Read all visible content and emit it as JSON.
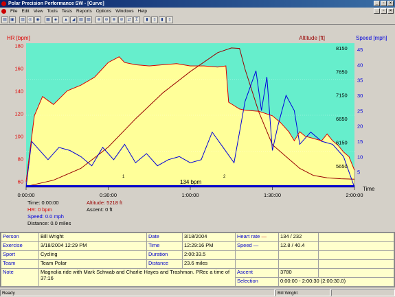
{
  "window": {
    "title": "Polar Precision Performance SW - [Curve]"
  },
  "menu": [
    "File",
    "Edit",
    "View",
    "Tools",
    "Tests",
    "Reports",
    "Options",
    "Windows",
    "Help"
  ],
  "toolbar": {
    "icons": [
      "open-icon",
      "save-icon",
      "print-icon",
      "preview-icon",
      "globe-icon",
      "calendar-icon",
      "diary-icon",
      "chart-icon",
      "chart2-icon",
      "chart3-icon",
      "chart4-icon",
      "zoom-icon",
      "zoom2-icon",
      "zoom3-icon",
      "zoom4-icon",
      "compare-icon",
      "sum-icon",
      "bar-icon",
      "bar2-icon",
      "bar3-icon",
      "bar4-icon"
    ]
  },
  "chart": {
    "hr_title": "HR [bpm]",
    "alt_title": "Altitude [ft]",
    "speed_title": "Speed [mph]",
    "time_label": "Time",
    "hr_ticks": [
      "180",
      "160",
      "140",
      "120",
      "100",
      "80",
      "60"
    ],
    "alt_ticks": [
      "8150",
      "7650",
      "7150",
      "6650",
      "6150",
      "5650"
    ],
    "speed_ticks": [
      "45",
      "40",
      "35",
      "30",
      "25",
      "20",
      "15",
      "10",
      "5"
    ],
    "time_ticks": [
      "0:00:00",
      "0:30:00",
      "1:00:00",
      "1:30:00",
      "2:00:00"
    ],
    "zone_label": "134 bpm",
    "lap_markers": [
      "1",
      "2"
    ],
    "cursor": {
      "time": "Time: 0:00:00",
      "hr": "HR: 0 bpm",
      "speed": "Speed: 0.0 mph",
      "distance": "Distance: 0.0 miles",
      "altitude": "Altitude: 5218 ft",
      "ascent": "Ascent: 0 ft"
    },
    "colors": {
      "plot_bg": "#66eecc",
      "zone_fill": "#ffff99",
      "hr": "#dd0000",
      "speed": "#0000dd",
      "altitude": "#990000"
    }
  },
  "chart_data": {
    "type": "line",
    "xlabel": "Time",
    "xlim": [
      "0:00:00",
      "2:00:00"
    ],
    "series": [
      {
        "name": "HR [bpm]",
        "axis": "left",
        "ylim": [
          55,
          182
        ],
        "x_min": [
          0,
          3,
          6,
          10,
          15,
          20,
          25,
          30,
          34,
          36,
          40,
          45,
          50,
          55,
          60,
          65,
          70,
          73,
          74,
          78,
          80,
          85,
          90,
          93,
          96,
          98,
          100,
          102,
          105,
          108,
          110,
          112,
          114,
          116,
          118,
          120
        ],
        "values": [
          60,
          118,
          135,
          128,
          140,
          145,
          152,
          165,
          170,
          165,
          163,
          162,
          163,
          164,
          162,
          162,
          161,
          162,
          130,
          124,
          123,
          122,
          118,
          112,
          104,
          96,
          104,
          100,
          98,
          96,
          102,
          96,
          92,
          86,
          82,
          70
        ]
      },
      {
        "name": "Altitude [ft]",
        "axis": "right",
        "ylim": [
          5200,
          8250
        ],
        "x_min": [
          0,
          10,
          20,
          30,
          40,
          50,
          60,
          70,
          75,
          78,
          80,
          85,
          90,
          95,
          100,
          105,
          110,
          115,
          120
        ],
        "values": [
          5218,
          5350,
          5600,
          6050,
          6650,
          7200,
          7650,
          8050,
          8150,
          8140,
          7700,
          6800,
          6100,
          5850,
          5600,
          5450,
          5400,
          5380,
          5370
        ]
      },
      {
        "name": "Speed [mph]",
        "axis": "right",
        "ylim": [
          0,
          47
        ],
        "x_min": [
          0,
          2,
          5,
          8,
          12,
          16,
          20,
          24,
          28,
          32,
          36,
          40,
          44,
          48,
          52,
          56,
          60,
          64,
          68,
          72,
          76,
          80,
          84,
          86,
          88,
          90,
          92,
          95,
          98,
          100,
          104,
          108,
          112,
          116,
          120
        ],
        "values": [
          0,
          15,
          12,
          9,
          13,
          12,
          10,
          7,
          13,
          9,
          14,
          8,
          11,
          7,
          9,
          10,
          8,
          9,
          18,
          13,
          8,
          28,
          38,
          25,
          36,
          12,
          20,
          30,
          25,
          14,
          18,
          15,
          14,
          10,
          0
        ]
      }
    ]
  },
  "summary": {
    "person_label": "Person",
    "person": "Bill Wright",
    "date_label": "Date",
    "date": "3/18/2004",
    "hr_label": "Heart rate",
    "hr": "134 / 232",
    "exercise_label": "Exercise",
    "exercise": "3/18/2004 12:29 PM",
    "time_label": "Time",
    "time": "12:29:16 PM",
    "speed_label": "Speed",
    "speed": "12.8 / 40.4",
    "sport_label": "Sport",
    "sport": "Cycling",
    "duration_label": "Duration",
    "duration": "2:00:33.5",
    "team_label": "Team",
    "team": "Team Polar",
    "distance_label": "Distance",
    "distance": "23.6 miles",
    "note_label": "Note",
    "note": "Magnolia ride with Mark Schwab and Charlie Hayes and Trashman. PRec a time of 37:16",
    "ascent_label": "Ascent",
    "ascent": "3780",
    "selection_label": "Selection",
    "selection": "0:00:00 - 2:00:30 (2:00:30.0)"
  },
  "status": {
    "left": "Ready",
    "user": "Bill Wright"
  }
}
